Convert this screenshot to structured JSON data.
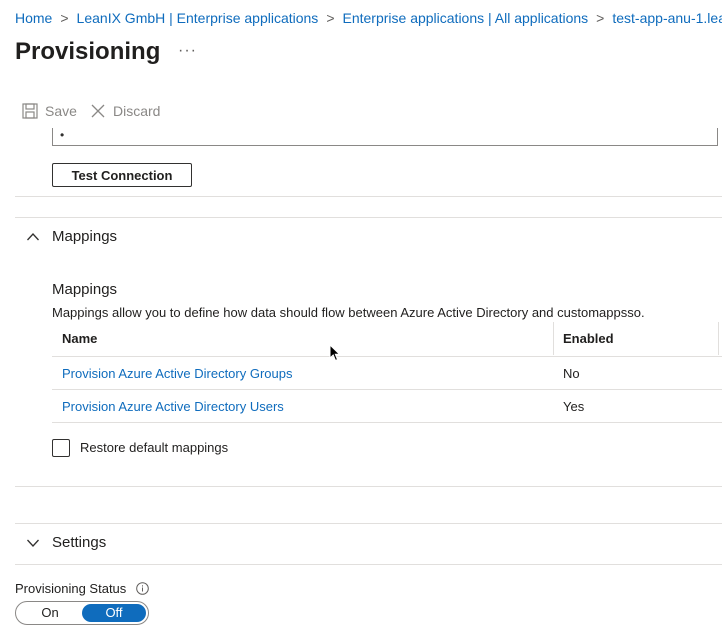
{
  "breadcrumb": {
    "items": [
      "Home",
      "LeanIX GmbH | Enterprise applications",
      "Enterprise applications | All applications",
      "test-app-anu-1.lea"
    ],
    "separator": ">"
  },
  "page": {
    "title": "Provisioning",
    "more": "···"
  },
  "toolbar": {
    "save_label": "Save",
    "discard_label": "Discard"
  },
  "credentials": {
    "secret_mask": "•",
    "test_connection_label": "Test Connection"
  },
  "mappings": {
    "header": "Mappings",
    "subtitle": "Mappings",
    "description": "Mappings allow you to define how data should flow between Azure Active Directory and customappsso.",
    "columns": [
      "Name",
      "Enabled"
    ],
    "rows": [
      {
        "name": "Provision Azure Active Directory Groups",
        "enabled": "No"
      },
      {
        "name": "Provision Azure Active Directory Users",
        "enabled": "Yes"
      }
    ],
    "restore_label": "Restore default mappings"
  },
  "settings": {
    "header": "Settings"
  },
  "provisioning_status": {
    "label": "Provisioning Status",
    "on_label": "On",
    "off_label": "Off",
    "selected": "Off"
  },
  "colors": {
    "accent": "#0f6cbd",
    "link": "#0f6cbd",
    "text": "#201f1e",
    "muted": "#8a8886",
    "divider": "#e1dfdd"
  }
}
